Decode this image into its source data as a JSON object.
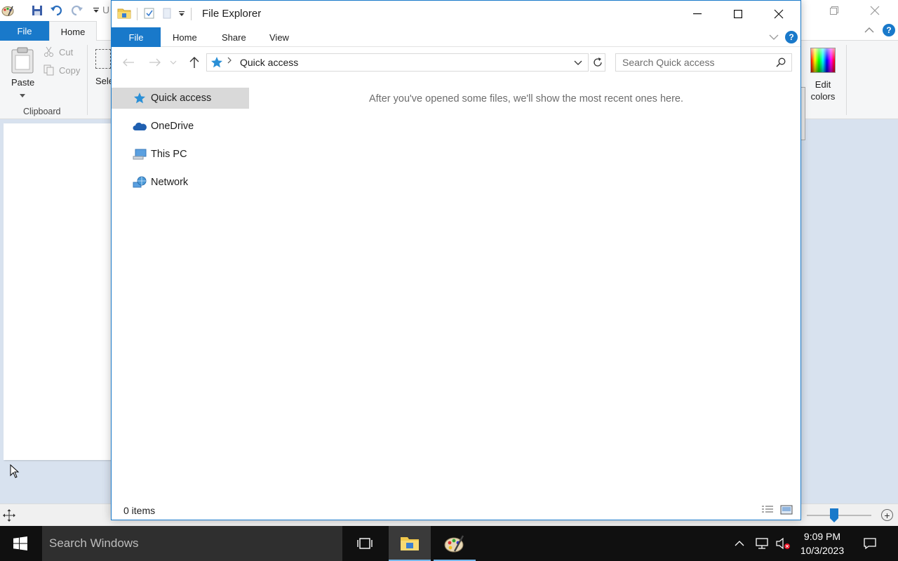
{
  "paint": {
    "title_fragment": "U",
    "tabs": {
      "file": "File",
      "home": "Home"
    },
    "clipboard": {
      "paste": "Paste",
      "cut": "Cut",
      "copy": "Copy",
      "group_label": "Clipboard"
    },
    "select_fragment": "Sele",
    "edit_colors": "Edit colors"
  },
  "explorer": {
    "title": "File Explorer",
    "ribbon_tabs": {
      "file": "File",
      "home": "Home",
      "share": "Share",
      "view": "View"
    },
    "address": {
      "current": "Quick access"
    },
    "search": {
      "placeholder": "Search Quick access"
    },
    "nav": {
      "items": [
        {
          "label": "Quick access",
          "icon": "star-icon",
          "selected": true
        },
        {
          "label": "OneDrive",
          "icon": "cloud-icon",
          "selected": false
        },
        {
          "label": "This PC",
          "icon": "computer-icon",
          "selected": false
        },
        {
          "label": "Network",
          "icon": "network-icon",
          "selected": false
        }
      ]
    },
    "empty_message": "After you've opened some files, we'll show the most recent ones here.",
    "status": {
      "item_count": "0 items"
    }
  },
  "taskbar": {
    "search_placeholder": "Search Windows",
    "time": "9:09 PM",
    "date": "10/3/2023"
  },
  "colors": {
    "accent": "#1979ca",
    "taskbar_bg": "#101010",
    "selection_bg": "#d9d9d9"
  }
}
